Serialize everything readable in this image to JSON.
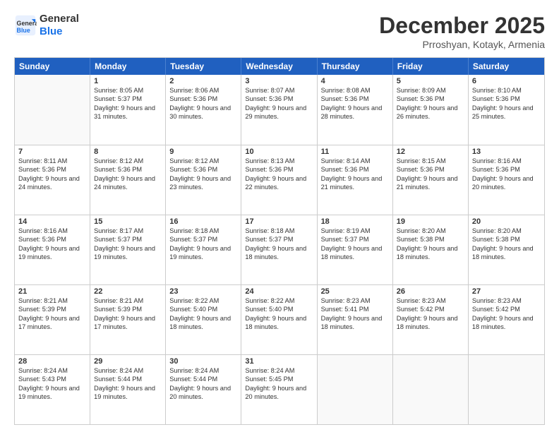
{
  "logo": {
    "line1": "General",
    "line2": "Blue"
  },
  "title": "December 2025",
  "location": "Prroshyan, Kotayk, Armenia",
  "days_of_week": [
    "Sunday",
    "Monday",
    "Tuesday",
    "Wednesday",
    "Thursday",
    "Friday",
    "Saturday"
  ],
  "weeks": [
    [
      {
        "day": "",
        "sunrise": "",
        "sunset": "",
        "daylight": ""
      },
      {
        "day": "1",
        "sunrise": "Sunrise: 8:05 AM",
        "sunset": "Sunset: 5:37 PM",
        "daylight": "Daylight: 9 hours and 31 minutes."
      },
      {
        "day": "2",
        "sunrise": "Sunrise: 8:06 AM",
        "sunset": "Sunset: 5:36 PM",
        "daylight": "Daylight: 9 hours and 30 minutes."
      },
      {
        "day": "3",
        "sunrise": "Sunrise: 8:07 AM",
        "sunset": "Sunset: 5:36 PM",
        "daylight": "Daylight: 9 hours and 29 minutes."
      },
      {
        "day": "4",
        "sunrise": "Sunrise: 8:08 AM",
        "sunset": "Sunset: 5:36 PM",
        "daylight": "Daylight: 9 hours and 28 minutes."
      },
      {
        "day": "5",
        "sunrise": "Sunrise: 8:09 AM",
        "sunset": "Sunset: 5:36 PM",
        "daylight": "Daylight: 9 hours and 26 minutes."
      },
      {
        "day": "6",
        "sunrise": "Sunrise: 8:10 AM",
        "sunset": "Sunset: 5:36 PM",
        "daylight": "Daylight: 9 hours and 25 minutes."
      }
    ],
    [
      {
        "day": "7",
        "sunrise": "Sunrise: 8:11 AM",
        "sunset": "Sunset: 5:36 PM",
        "daylight": "Daylight: 9 hours and 24 minutes."
      },
      {
        "day": "8",
        "sunrise": "Sunrise: 8:12 AM",
        "sunset": "Sunset: 5:36 PM",
        "daylight": "Daylight: 9 hours and 24 minutes."
      },
      {
        "day": "9",
        "sunrise": "Sunrise: 8:12 AM",
        "sunset": "Sunset: 5:36 PM",
        "daylight": "Daylight: 9 hours and 23 minutes."
      },
      {
        "day": "10",
        "sunrise": "Sunrise: 8:13 AM",
        "sunset": "Sunset: 5:36 PM",
        "daylight": "Daylight: 9 hours and 22 minutes."
      },
      {
        "day": "11",
        "sunrise": "Sunrise: 8:14 AM",
        "sunset": "Sunset: 5:36 PM",
        "daylight": "Daylight: 9 hours and 21 minutes."
      },
      {
        "day": "12",
        "sunrise": "Sunrise: 8:15 AM",
        "sunset": "Sunset: 5:36 PM",
        "daylight": "Daylight: 9 hours and 21 minutes."
      },
      {
        "day": "13",
        "sunrise": "Sunrise: 8:16 AM",
        "sunset": "Sunset: 5:36 PM",
        "daylight": "Daylight: 9 hours and 20 minutes."
      }
    ],
    [
      {
        "day": "14",
        "sunrise": "Sunrise: 8:16 AM",
        "sunset": "Sunset: 5:36 PM",
        "daylight": "Daylight: 9 hours and 19 minutes."
      },
      {
        "day": "15",
        "sunrise": "Sunrise: 8:17 AM",
        "sunset": "Sunset: 5:37 PM",
        "daylight": "Daylight: 9 hours and 19 minutes."
      },
      {
        "day": "16",
        "sunrise": "Sunrise: 8:18 AM",
        "sunset": "Sunset: 5:37 PM",
        "daylight": "Daylight: 9 hours and 19 minutes."
      },
      {
        "day": "17",
        "sunrise": "Sunrise: 8:18 AM",
        "sunset": "Sunset: 5:37 PM",
        "daylight": "Daylight: 9 hours and 18 minutes."
      },
      {
        "day": "18",
        "sunrise": "Sunrise: 8:19 AM",
        "sunset": "Sunset: 5:37 PM",
        "daylight": "Daylight: 9 hours and 18 minutes."
      },
      {
        "day": "19",
        "sunrise": "Sunrise: 8:20 AM",
        "sunset": "Sunset: 5:38 PM",
        "daylight": "Daylight: 9 hours and 18 minutes."
      },
      {
        "day": "20",
        "sunrise": "Sunrise: 8:20 AM",
        "sunset": "Sunset: 5:38 PM",
        "daylight": "Daylight: 9 hours and 18 minutes."
      }
    ],
    [
      {
        "day": "21",
        "sunrise": "Sunrise: 8:21 AM",
        "sunset": "Sunset: 5:39 PM",
        "daylight": "Daylight: 9 hours and 17 minutes."
      },
      {
        "day": "22",
        "sunrise": "Sunrise: 8:21 AM",
        "sunset": "Sunset: 5:39 PM",
        "daylight": "Daylight: 9 hours and 17 minutes."
      },
      {
        "day": "23",
        "sunrise": "Sunrise: 8:22 AM",
        "sunset": "Sunset: 5:40 PM",
        "daylight": "Daylight: 9 hours and 18 minutes."
      },
      {
        "day": "24",
        "sunrise": "Sunrise: 8:22 AM",
        "sunset": "Sunset: 5:40 PM",
        "daylight": "Daylight: 9 hours and 18 minutes."
      },
      {
        "day": "25",
        "sunrise": "Sunrise: 8:23 AM",
        "sunset": "Sunset: 5:41 PM",
        "daylight": "Daylight: 9 hours and 18 minutes."
      },
      {
        "day": "26",
        "sunrise": "Sunrise: 8:23 AM",
        "sunset": "Sunset: 5:42 PM",
        "daylight": "Daylight: 9 hours and 18 minutes."
      },
      {
        "day": "27",
        "sunrise": "Sunrise: 8:23 AM",
        "sunset": "Sunset: 5:42 PM",
        "daylight": "Daylight: 9 hours and 18 minutes."
      }
    ],
    [
      {
        "day": "28",
        "sunrise": "Sunrise: 8:24 AM",
        "sunset": "Sunset: 5:43 PM",
        "daylight": "Daylight: 9 hours and 19 minutes."
      },
      {
        "day": "29",
        "sunrise": "Sunrise: 8:24 AM",
        "sunset": "Sunset: 5:44 PM",
        "daylight": "Daylight: 9 hours and 19 minutes."
      },
      {
        "day": "30",
        "sunrise": "Sunrise: 8:24 AM",
        "sunset": "Sunset: 5:44 PM",
        "daylight": "Daylight: 9 hours and 20 minutes."
      },
      {
        "day": "31",
        "sunrise": "Sunrise: 8:24 AM",
        "sunset": "Sunset: 5:45 PM",
        "daylight": "Daylight: 9 hours and 20 minutes."
      },
      {
        "day": "",
        "sunrise": "",
        "sunset": "",
        "daylight": ""
      },
      {
        "day": "",
        "sunrise": "",
        "sunset": "",
        "daylight": ""
      },
      {
        "day": "",
        "sunrise": "",
        "sunset": "",
        "daylight": ""
      }
    ]
  ]
}
